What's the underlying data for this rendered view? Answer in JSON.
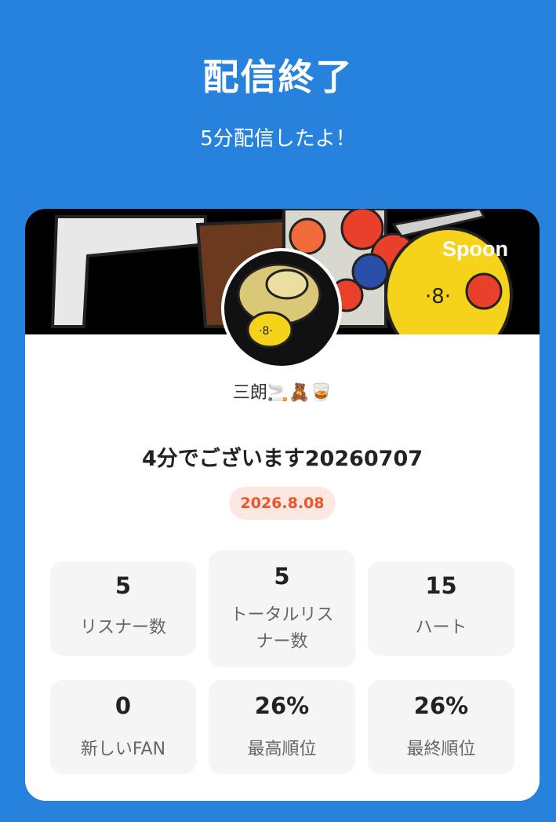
{
  "header": {
    "title": "配信終了",
    "subtitle": "5分配信したよ！"
  },
  "card": {
    "brand": "Spoon",
    "username": "三朗🚬🧸🥃",
    "stream_title": "4分でございます20260707",
    "date": "2026.8.08",
    "colors": {
      "accent": "#2782DE",
      "date_text": "#F0522B",
      "date_bg": "#FDE8E1"
    },
    "stats": [
      {
        "value": "5",
        "label": "リスナー数"
      },
      {
        "value": "5",
        "label": "トータルリス\nナー数"
      },
      {
        "value": "15",
        "label": "ハート"
      },
      {
        "value": "0",
        "label": "新しいFAN"
      },
      {
        "value": "26%",
        "label": "最高順位"
      },
      {
        "value": "26%",
        "label": "最終順位"
      }
    ]
  }
}
